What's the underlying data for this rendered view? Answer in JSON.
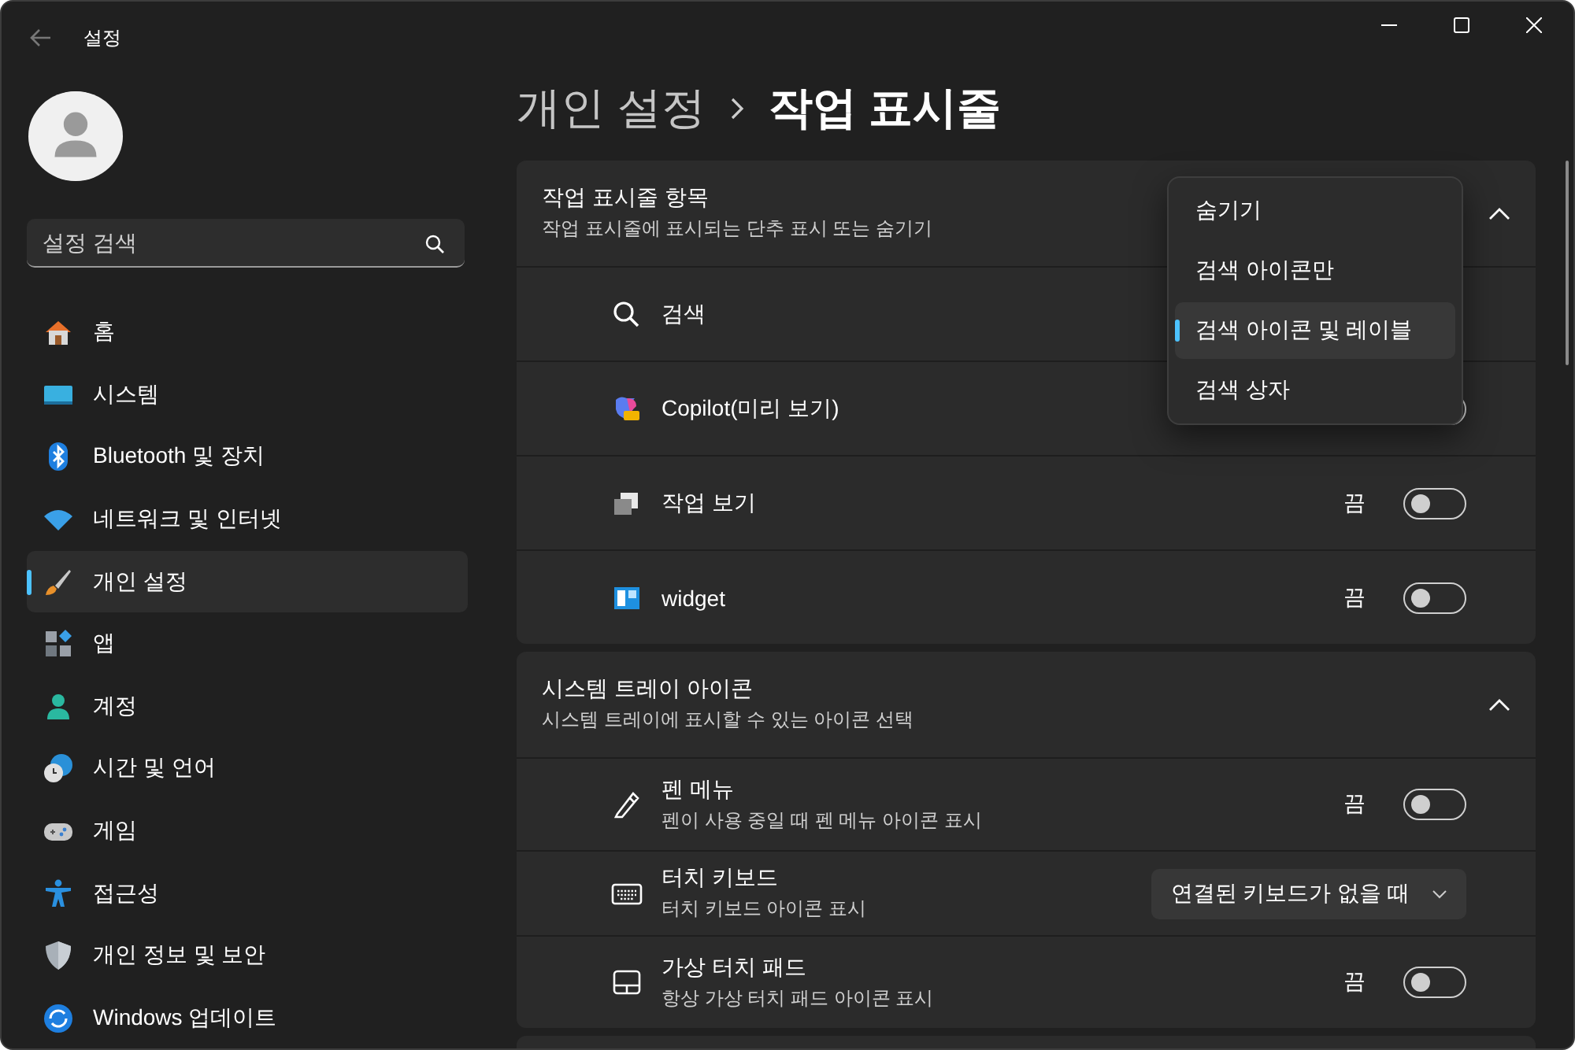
{
  "window": {
    "title": "설정"
  },
  "sidebar": {
    "search": {
      "placeholder": "설정 검색"
    },
    "items": [
      {
        "label": "홈",
        "selected": false
      },
      {
        "label": "시스템",
        "selected": false
      },
      {
        "label": "Bluetooth 및 장치",
        "selected": false
      },
      {
        "label": "네트워크 및 인터넷",
        "selected": false
      },
      {
        "label": "개인 설정",
        "selected": true
      },
      {
        "label": "앱",
        "selected": false
      },
      {
        "label": "계정",
        "selected": false
      },
      {
        "label": "시간 및 언어",
        "selected": false
      },
      {
        "label": "게임",
        "selected": false
      },
      {
        "label": "접근성",
        "selected": false
      },
      {
        "label": "개인 정보 및 보안",
        "selected": false
      },
      {
        "label": "Windows 업데이트",
        "selected": false
      }
    ]
  },
  "breadcrumb": [
    "개인 설정",
    "작업 표시줄"
  ],
  "sections": [
    {
      "title": "작업 표시줄 항목",
      "subtitle": "작업 표시줄에 표시되는 단추 표시 또는 숨기기",
      "expanded": true,
      "rows": [
        {
          "kind": "plain",
          "label": "검색"
        },
        {
          "kind": "toggle",
          "label": "Copilot(미리 보기)",
          "on": false
        },
        {
          "kind": "toggle",
          "label": "작업 보기",
          "state_text": "끔",
          "on": false
        },
        {
          "kind": "toggle",
          "label": "widget",
          "state_text": "끔",
          "on": false
        }
      ]
    },
    {
      "title": "시스템 트레이 아이콘",
      "subtitle": "시스템 트레이에 표시할 수 있는 아이콘 선택",
      "expanded": true,
      "rows": [
        {
          "kind": "toggle",
          "label": "펜 메뉴",
          "description": "펜이 사용 중일 때 펜 메뉴 아이콘 표시",
          "state_text": "끔",
          "on": false
        },
        {
          "kind": "dropdown",
          "label": "터치 키보드",
          "description": "터치 키보드 아이콘 표시",
          "value": "연결된 키보드가 없을 때"
        },
        {
          "kind": "toggle",
          "label": "가상 터치 패드",
          "description": "항상 가상 터치 패드 아이콘 표시",
          "state_text": "끔",
          "on": false
        }
      ]
    }
  ],
  "menu": {
    "items": [
      {
        "label": "숨기기",
        "selected": false
      },
      {
        "label": "검색 아이콘만",
        "selected": false
      },
      {
        "label": "검색 아이콘 및 레이블",
        "selected": true
      },
      {
        "label": "검색 상자",
        "selected": false
      }
    ]
  }
}
